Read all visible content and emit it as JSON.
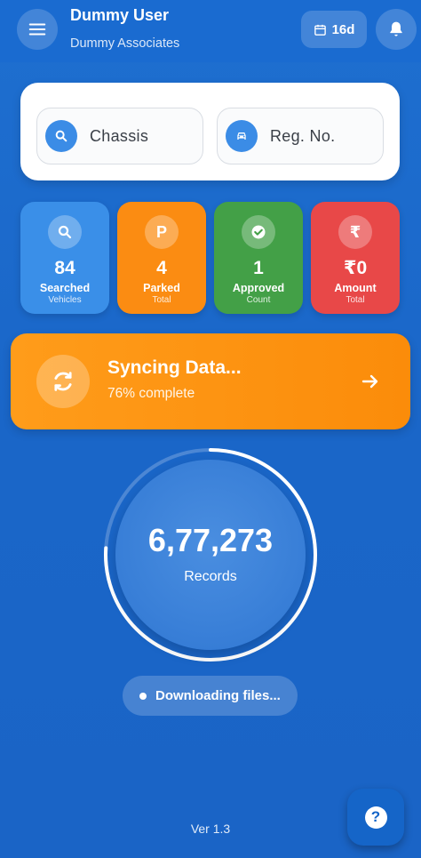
{
  "header": {
    "user_name": "Dummy User",
    "company": "Dummy Associates",
    "days_badge": "16d",
    "icons": [
      "menu-icon",
      "calendar-icon",
      "bell-icon"
    ]
  },
  "search": {
    "chassis_label": "Chassis",
    "reg_label": "Reg. No.",
    "icons": [
      "search-icon",
      "car-icon"
    ]
  },
  "stats": [
    {
      "icon": "search-icon",
      "value": "84",
      "label": "Searched",
      "sub": "Vehicles",
      "color": "#3a8fe8"
    },
    {
      "icon": "P",
      "value": "4",
      "label": "Parked",
      "sub": "Total",
      "color": "#fb8c12"
    },
    {
      "icon": "check-icon",
      "value": "1",
      "label": "Approved",
      "sub": "Count",
      "color": "#43a047"
    },
    {
      "icon": "₹",
      "value": "₹0",
      "label": "Amount",
      "sub": "Total",
      "color": "#e84848"
    }
  ],
  "sync": {
    "title": "Syncing Data...",
    "status": "76% complete",
    "progress": 0.76
  },
  "records": {
    "value": "6,77,273",
    "label": "Records"
  },
  "download_status": "Downloading files...",
  "version": "Ver 1.3",
  "colors": {
    "background": "#1a6bd0",
    "sync_card": "#fb8c0a",
    "card_white": "#ffffff"
  }
}
